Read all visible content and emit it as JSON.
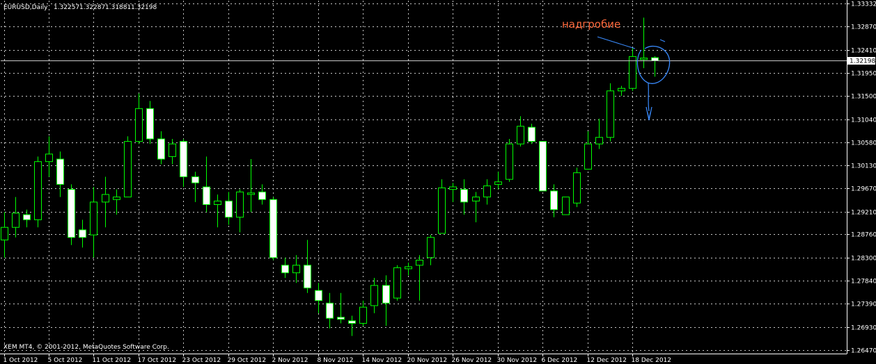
{
  "header": {
    "symbol": "EURUSD,Daily",
    "o": "1.32257",
    "h": "1.32287",
    "l": "1.31881",
    "c": "1.32198"
  },
  "footer": {
    "copyright": "XEM MT4, © 2001-2012, MetaQuotes Software Corp."
  },
  "annotation": {
    "label": "надгробие"
  },
  "current_price_label": "1.32198",
  "colors": {
    "background": "#000000",
    "grid": "#c8c8c8",
    "axis": "#ffffff",
    "bull_body": "#000000",
    "bear_body": "#ffffff",
    "candle_outline": "#00ff00",
    "annotation_text": "#ff6a3d",
    "drawing": "#3a8cff"
  },
  "chart_data": {
    "type": "candlestick",
    "symbol": "EURUSD",
    "timeframe": "Daily",
    "ylim": [
      1.2647,
      1.3333
    ],
    "y_ticks": [
      "1.33332",
      "1.32870",
      "1.32410",
      "1.31950",
      "1.31500",
      "1.31040",
      "1.30580",
      "1.30130",
      "1.29670",
      "1.29210",
      "1.28760",
      "1.28300",
      "1.27840",
      "1.27390",
      "1.26930",
      "1.26470"
    ],
    "x_ticks": [
      {
        "label": "1 Oct 2012",
        "index": 0
      },
      {
        "label": "5 Oct 2012",
        "index": 4
      },
      {
        "label": "11 Oct 2012",
        "index": 8
      },
      {
        "label": "17 Oct 2012",
        "index": 12
      },
      {
        "label": "23 Oct 2012",
        "index": 16
      },
      {
        "label": "29 Oct 2012",
        "index": 20
      },
      {
        "label": "2 Nov 2012",
        "index": 24
      },
      {
        "label": "8 Nov 2012",
        "index": 28
      },
      {
        "label": "14 Nov 2012",
        "index": 32
      },
      {
        "label": "20 Nov 2012",
        "index": 36
      },
      {
        "label": "26 Nov 2012",
        "index": 40
      },
      {
        "label": "30 Nov 2012",
        "index": 44
      },
      {
        "label": "6 Dec 2012",
        "index": 48
      },
      {
        "label": "12 Dec 2012",
        "index": 52
      },
      {
        "label": "18 Dec 2012",
        "index": 56
      }
    ],
    "grid": true,
    "candles": [
      {
        "o": 1.2865,
        "h": 1.292,
        "l": 1.283,
        "c": 1.289
      },
      {
        "o": 1.289,
        "h": 1.295,
        "l": 1.287,
        "c": 1.2918
      },
      {
        "o": 1.2915,
        "h": 1.2925,
        "l": 1.289,
        "c": 1.2905
      },
      {
        "o": 1.2905,
        "h": 1.303,
        "l": 1.289,
        "c": 1.302
      },
      {
        "o": 1.302,
        "h": 1.307,
        "l": 1.299,
        "c": 1.3035
      },
      {
        "o": 1.3025,
        "h": 1.304,
        "l": 1.295,
        "c": 1.2975
      },
      {
        "o": 1.2965,
        "h": 1.2975,
        "l": 1.2855,
        "c": 1.287
      },
      {
        "o": 1.2885,
        "h": 1.2905,
        "l": 1.285,
        "c": 1.287
      },
      {
        "o": 1.2875,
        "h": 1.297,
        "l": 1.283,
        "c": 1.294
      },
      {
        "o": 1.294,
        "h": 1.299,
        "l": 1.289,
        "c": 1.2955
      },
      {
        "o": 1.2945,
        "h": 1.2965,
        "l": 1.2915,
        "c": 1.295
      },
      {
        "o": 1.295,
        "h": 1.307,
        "l": 1.295,
        "c": 1.306
      },
      {
        "o": 1.306,
        "h": 1.3155,
        "l": 1.3055,
        "c": 1.3125
      },
      {
        "o": 1.3125,
        "h": 1.314,
        "l": 1.3055,
        "c": 1.3065
      },
      {
        "o": 1.3065,
        "h": 1.308,
        "l": 1.3015,
        "c": 1.3025
      },
      {
        "o": 1.303,
        "h": 1.3065,
        "l": 1.3015,
        "c": 1.3055
      },
      {
        "o": 1.306,
        "h": 1.3065,
        "l": 1.297,
        "c": 1.299
      },
      {
        "o": 1.299,
        "h": 1.3,
        "l": 1.294,
        "c": 1.2978
      },
      {
        "o": 1.297,
        "h": 1.303,
        "l": 1.292,
        "c": 1.2935
      },
      {
        "o": 1.2935,
        "h": 1.2955,
        "l": 1.289,
        "c": 1.2942
      },
      {
        "o": 1.2942,
        "h": 1.296,
        "l": 1.2895,
        "c": 1.291
      },
      {
        "o": 1.291,
        "h": 1.2965,
        "l": 1.288,
        "c": 1.296
      },
      {
        "o": 1.2955,
        "h": 1.3025,
        "l": 1.292,
        "c": 1.2958
      },
      {
        "o": 1.296,
        "h": 1.2975,
        "l": 1.2935,
        "c": 1.2945
      },
      {
        "o": 1.2945,
        "h": 1.295,
        "l": 1.2825,
        "c": 1.283
      },
      {
        "o": 1.2815,
        "h": 1.283,
        "l": 1.279,
        "c": 1.28
      },
      {
        "o": 1.28,
        "h": 1.2835,
        "l": 1.278,
        "c": 1.2815
      },
      {
        "o": 1.2815,
        "h": 1.2865,
        "l": 1.276,
        "c": 1.277
      },
      {
        "o": 1.2765,
        "h": 1.278,
        "l": 1.272,
        "c": 1.2745
      },
      {
        "o": 1.274,
        "h": 1.276,
        "l": 1.269,
        "c": 1.271
      },
      {
        "o": 1.2712,
        "h": 1.276,
        "l": 1.27,
        "c": 1.2708
      },
      {
        "o": 1.2705,
        "h": 1.2715,
        "l": 1.2675,
        "c": 1.27
      },
      {
        "o": 1.27,
        "h": 1.2745,
        "l": 1.2695,
        "c": 1.2732
      },
      {
        "o": 1.2735,
        "h": 1.279,
        "l": 1.272,
        "c": 1.2775
      },
      {
        "o": 1.2775,
        "h": 1.2795,
        "l": 1.2695,
        "c": 1.274
      },
      {
        "o": 1.275,
        "h": 1.2815,
        "l": 1.2745,
        "c": 1.281
      },
      {
        "o": 1.2808,
        "h": 1.282,
        "l": 1.2795,
        "c": 1.2812
      },
      {
        "o": 1.2815,
        "h": 1.2835,
        "l": 1.2745,
        "c": 1.2825
      },
      {
        "o": 1.283,
        "h": 1.2875,
        "l": 1.2815,
        "c": 1.287
      },
      {
        "o": 1.2878,
        "h": 1.2985,
        "l": 1.288,
        "c": 1.2968
      },
      {
        "o": 1.2965,
        "h": 1.2978,
        "l": 1.294,
        "c": 1.297
      },
      {
        "o": 1.2965,
        "h": 1.2985,
        "l": 1.2915,
        "c": 1.294
      },
      {
        "o": 1.2942,
        "h": 1.296,
        "l": 1.29,
        "c": 1.295
      },
      {
        "o": 1.295,
        "h": 1.2985,
        "l": 1.2935,
        "c": 1.2972
      },
      {
        "o": 1.2975,
        "h": 1.3,
        "l": 1.2965,
        "c": 1.298
      },
      {
        "o": 1.2985,
        "h": 1.3065,
        "l": 1.298,
        "c": 1.3055
      },
      {
        "o": 1.3055,
        "h": 1.311,
        "l": 1.305,
        "c": 1.309
      },
      {
        "o": 1.3088,
        "h": 1.3095,
        "l": 1.3055,
        "c": 1.306
      },
      {
        "o": 1.306,
        "h": 1.306,
        "l": 1.2962,
        "c": 1.2962
      },
      {
        "o": 1.2962,
        "h": 1.2975,
        "l": 1.291,
        "c": 1.2925
      },
      {
        "o": 1.2915,
        "h": 1.295,
        "l": 1.2915,
        "c": 1.295
      },
      {
        "o": 1.2938,
        "h": 1.3008,
        "l": 1.293,
        "c": 1.2998
      },
      {
        "o": 1.3005,
        "h": 1.308,
        "l": 1.3005,
        "c": 1.3055
      },
      {
        "o": 1.3055,
        "h": 1.3105,
        "l": 1.3045,
        "c": 1.3068
      },
      {
        "o": 1.3068,
        "h": 1.3175,
        "l": 1.306,
        "c": 1.316
      },
      {
        "o": 1.316,
        "h": 1.317,
        "l": 1.315,
        "c": 1.3165
      },
      {
        "o": 1.3165,
        "h": 1.3245,
        "l": 1.316,
        "c": 1.3228
      },
      {
        "o": 1.3222,
        "h": 1.3305,
        "l": 1.3205,
        "c": 1.3225
      },
      {
        "o": 1.32257,
        "h": 1.32287,
        "l": 1.31881,
        "c": 1.32198
      }
    ]
  }
}
